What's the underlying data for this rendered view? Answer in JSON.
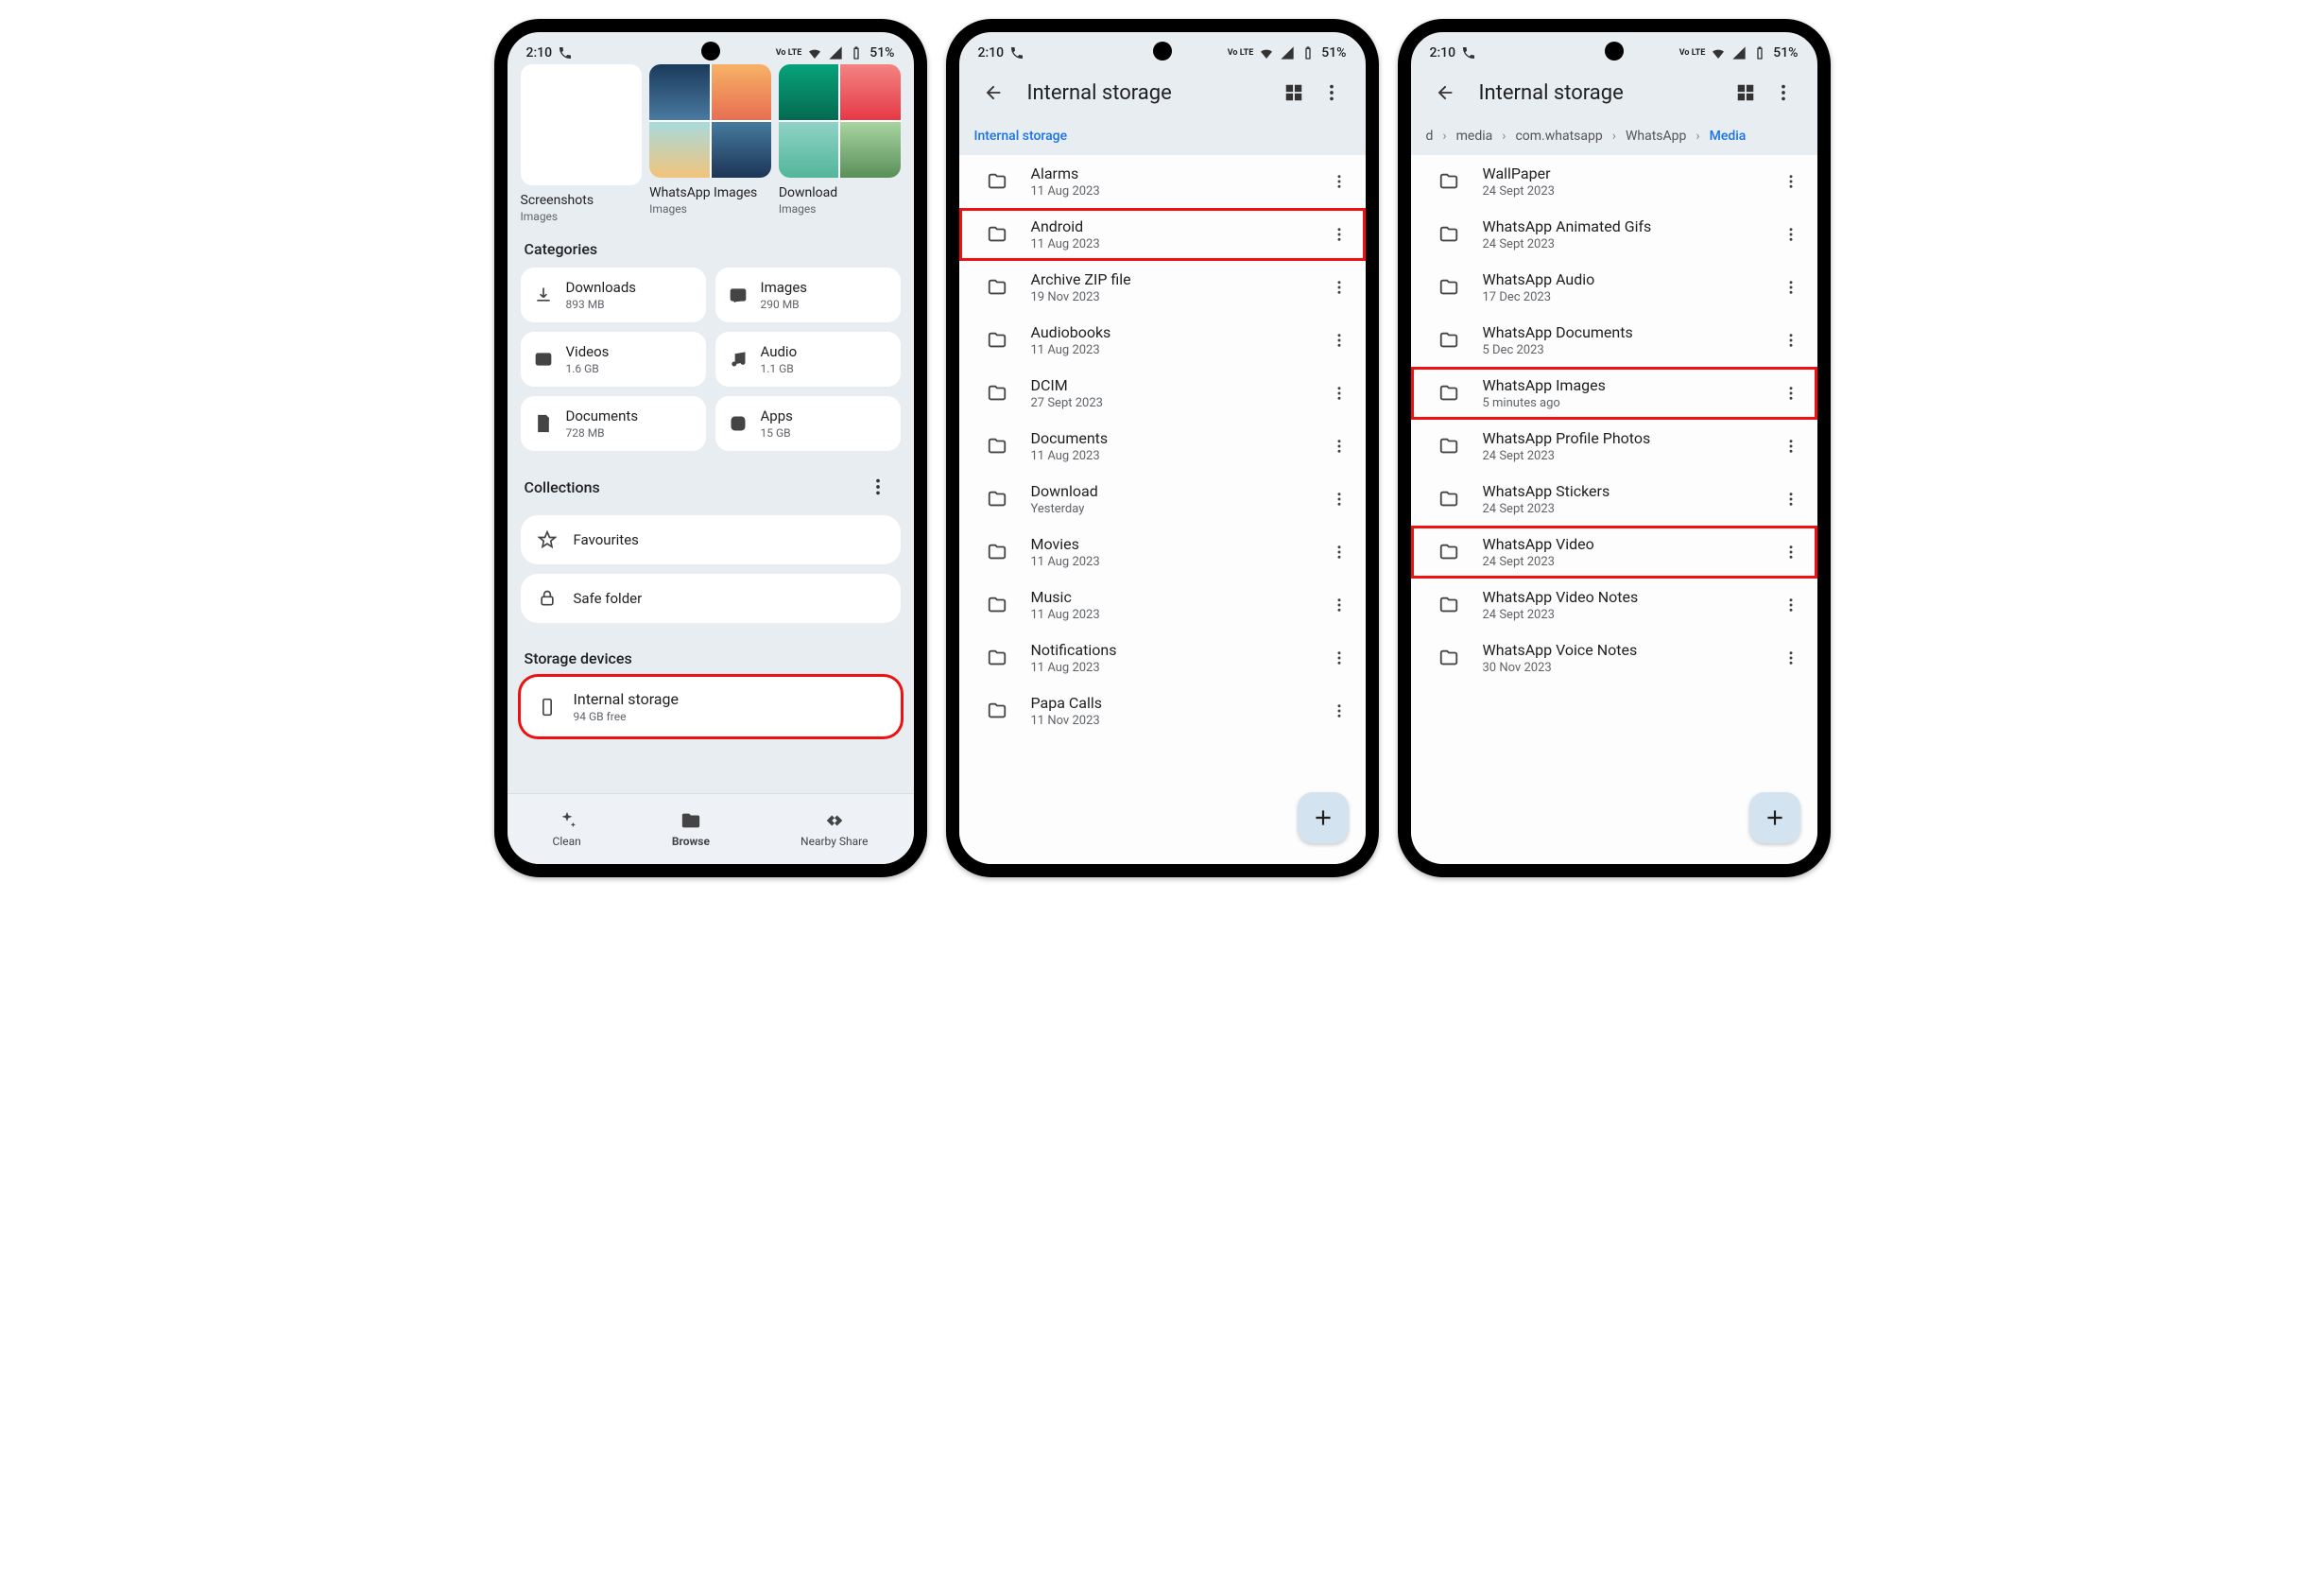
{
  "status": {
    "time": "2:10",
    "battery": "51%",
    "lte": "Vo LTE"
  },
  "p1": {
    "tiles": [
      {
        "name": "Screenshots",
        "sub": "Images"
      },
      {
        "name": "WhatsApp Images",
        "sub": "Images"
      },
      {
        "name": "Download",
        "sub": "Images"
      }
    ],
    "sec_categories": "Categories",
    "cats": [
      {
        "name": "Downloads",
        "sub": "893 MB"
      },
      {
        "name": "Images",
        "sub": "290 MB"
      },
      {
        "name": "Videos",
        "sub": "1.6 GB"
      },
      {
        "name": "Audio",
        "sub": "1.1 GB"
      },
      {
        "name": "Documents",
        "sub": "728 MB"
      },
      {
        "name": "Apps",
        "sub": "15 GB"
      }
    ],
    "sec_collections": "Collections",
    "coll": [
      {
        "name": "Favourites"
      },
      {
        "name": "Safe folder"
      }
    ],
    "sec_storage": "Storage devices",
    "storage": {
      "name": "Internal storage",
      "sub": "94 GB free"
    },
    "nav": [
      "Clean",
      "Browse",
      "Nearby Share"
    ]
  },
  "p2": {
    "title": "Internal storage",
    "crumb": "Internal storage",
    "rows": [
      {
        "name": "Alarms",
        "date": "11 Aug 2023",
        "hl": false
      },
      {
        "name": "Android",
        "date": "11 Aug 2023",
        "hl": true
      },
      {
        "name": "Archive ZIP file",
        "date": "19 Nov 2023",
        "hl": false
      },
      {
        "name": "Audiobooks",
        "date": "11 Aug 2023",
        "hl": false
      },
      {
        "name": "DCIM",
        "date": "27 Sept 2023",
        "hl": false
      },
      {
        "name": "Documents",
        "date": "11 Aug 2023",
        "hl": false
      },
      {
        "name": "Download",
        "date": "Yesterday",
        "hl": false
      },
      {
        "name": "Movies",
        "date": "11 Aug 2023",
        "hl": false
      },
      {
        "name": "Music",
        "date": "11 Aug 2023",
        "hl": false
      },
      {
        "name": "Notifications",
        "date": "11 Aug 2023",
        "hl": false
      },
      {
        "name": "Papa Calls",
        "date": "11 Nov 2023",
        "hl": false
      }
    ]
  },
  "p3": {
    "title": "Internal storage",
    "crumbs": [
      "d",
      "media",
      "com.whatsapp",
      "WhatsApp",
      "Media"
    ],
    "rows": [
      {
        "name": "WallPaper",
        "date": "24 Sept 2023",
        "hl": false
      },
      {
        "name": "WhatsApp Animated Gifs",
        "date": "24 Sept 2023",
        "hl": false
      },
      {
        "name": "WhatsApp Audio",
        "date": "17 Dec 2023",
        "hl": false
      },
      {
        "name": "WhatsApp Documents",
        "date": "5 Dec 2023",
        "hl": false
      },
      {
        "name": "WhatsApp Images",
        "date": "5 minutes ago",
        "hl": true
      },
      {
        "name": "WhatsApp Profile Photos",
        "date": "24 Sept 2023",
        "hl": false
      },
      {
        "name": "WhatsApp Stickers",
        "date": "24 Sept 2023",
        "hl": false
      },
      {
        "name": "WhatsApp Video",
        "date": "24 Sept 2023",
        "hl": true
      },
      {
        "name": "WhatsApp Video Notes",
        "date": "24 Sept 2023",
        "hl": false
      },
      {
        "name": "WhatsApp Voice Notes",
        "date": "30 Nov 2023",
        "hl": false
      }
    ]
  }
}
